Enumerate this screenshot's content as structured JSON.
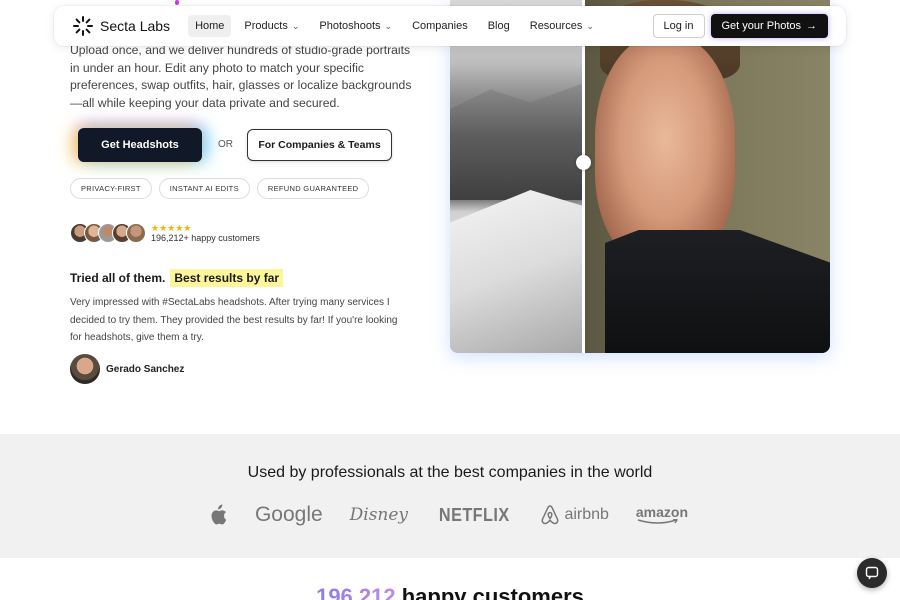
{
  "nav": {
    "brand": "Secta Labs",
    "items": [
      {
        "label": "Home",
        "dropdown": false
      },
      {
        "label": "Products",
        "dropdown": true
      },
      {
        "label": "Photoshoots",
        "dropdown": true
      },
      {
        "label": "Companies",
        "dropdown": false
      },
      {
        "label": "Blog",
        "dropdown": false
      },
      {
        "label": "Resources",
        "dropdown": true
      }
    ],
    "login": "Log in",
    "cta": "Get your Photos",
    "cta_arrow": "→"
  },
  "hero": {
    "description": "Upload once, and we deliver hundreds of studio-grade portraits in under an hour. Edit any photo to match your specific preferences, swap outfits, hair, glasses or localize backgrounds —all while keeping your data private and secured.",
    "primary_button": "Get Headshots",
    "or": "OR",
    "secondary_button": "For Companies & Teams",
    "pills": [
      "PRIVACY-FIRST",
      "INSTANT AI EDITS",
      "REFUND GUARANTEED"
    ],
    "rating_stars": "★★★★★",
    "customers_text": "196,212+ happy customers"
  },
  "review": {
    "lead": "Tried all of them.",
    "highlight": "Best results by far",
    "body": "Very impressed with #SectaLabs headshots. After trying many services I decided to try them. They provided the best results by far! If you're looking for headshots, give them a try.",
    "author": "Gerado Sanchez"
  },
  "logos": {
    "title": "Used by professionals at the best companies in the world",
    "items": [
      "apple-logo",
      "Google",
      "Disney",
      "NETFLIX",
      "airbnb",
      "amazon"
    ],
    "google": "Google",
    "disney": "Disney",
    "netflix": "NETFLIX",
    "airbnb": "airbnb",
    "amazon": "amazon"
  },
  "bottom": {
    "number": "196,212",
    "text": "happy customers"
  },
  "colors": {
    "dark": "#111827",
    "highlight": "#fdf59c",
    "band": "#f1f1f2",
    "stars": "#f4b400"
  }
}
